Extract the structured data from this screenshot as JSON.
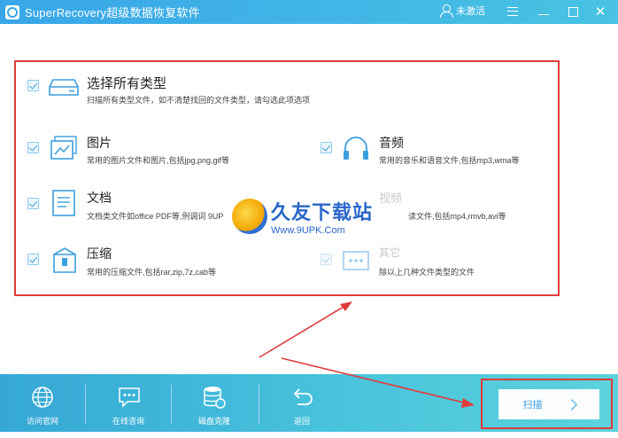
{
  "app": {
    "title": "SuperRecovery超级数据恢复软件",
    "user_status": "未激活"
  },
  "file_types": {
    "all": {
      "title": "选择所有类型",
      "desc": "扫描所有类型文件，如不清楚找回的文件类型，请勾选此项选项"
    },
    "image": {
      "title": "图片",
      "desc": "常用的图片文件和图片,包括jpg,png,gif等"
    },
    "audio": {
      "title": "音频",
      "desc": "常用的音乐和语音文件,包括mp3,wma等"
    },
    "doc": {
      "title": "文档",
      "desc": "文档类文件如office PDF等,例调词 9UP"
    },
    "video": {
      "title": "视频",
      "desc": "读文件,包括mp4,rmvb,avi等"
    },
    "zip": {
      "title": "压缩",
      "desc": "常用的压缩文件,包括rar,zip,7z,cab等"
    },
    "other": {
      "title": "其它",
      "desc": "除以上几种文件类型的文件"
    }
  },
  "watermark": {
    "name": "久友下载站",
    "url": "Www.9UPK.Com"
  },
  "bottom": {
    "website": "访问官网",
    "consult": "在线咨询",
    "clone": "磁盘克隆",
    "back": "返回",
    "scan": "扫描"
  },
  "colors": {
    "accent": "#3a9fe0",
    "highlight": "#e03b3b"
  }
}
